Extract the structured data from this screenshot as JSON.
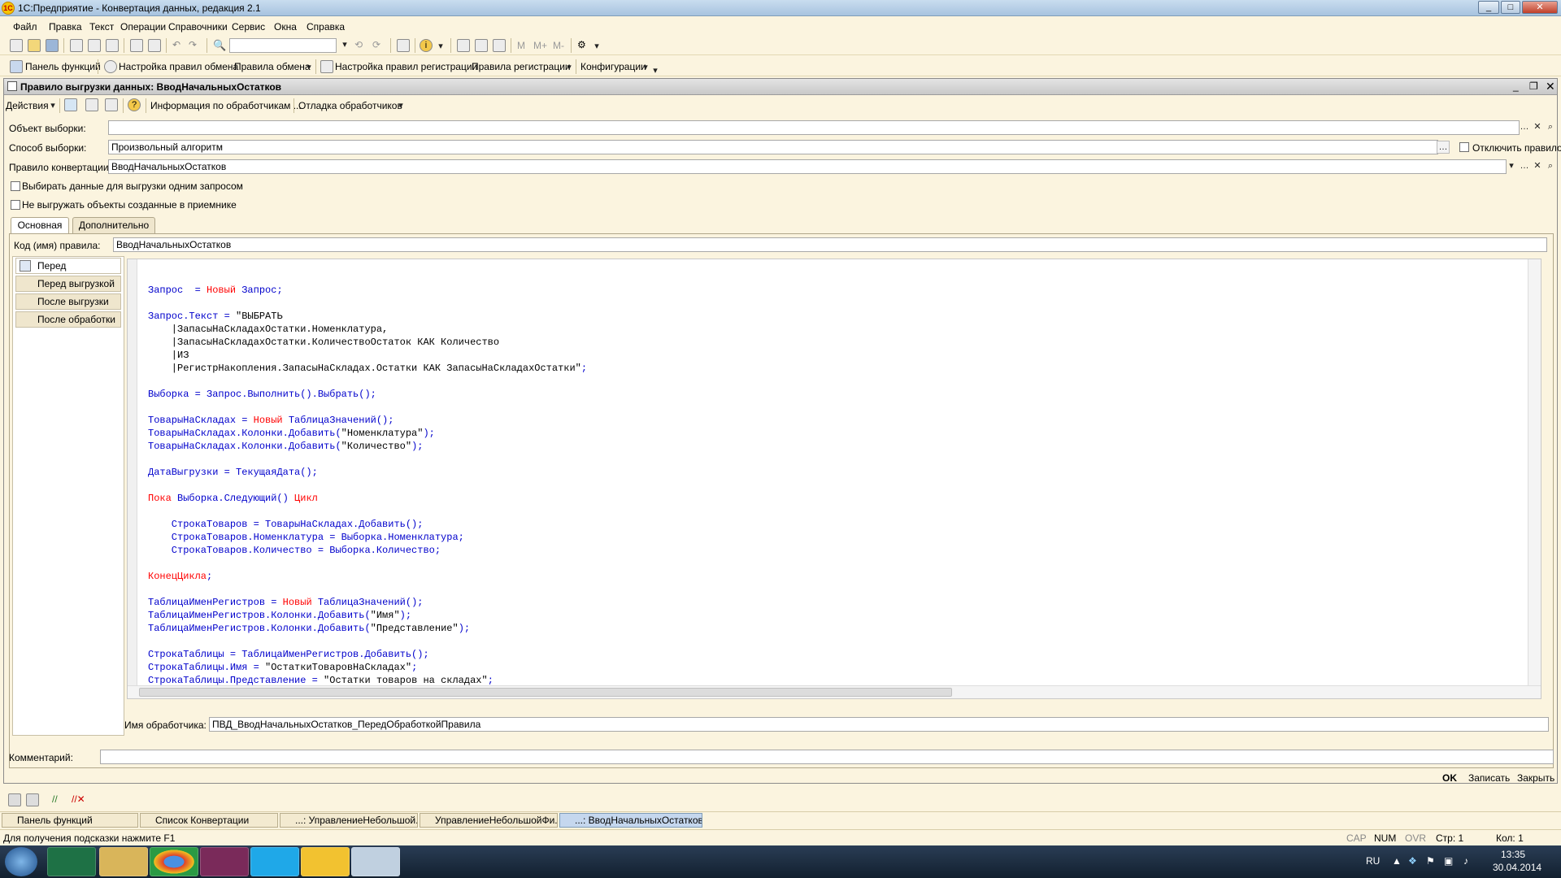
{
  "app": {
    "title": "1С:Предприятие - Конвертация данных, редакция 2.1"
  },
  "menu": [
    "Файл",
    "Правка",
    "Текст",
    "Операции",
    "Справочники",
    "Сервис",
    "Окна",
    "Справка"
  ],
  "toolbar2": {
    "panel": "Панель функций",
    "rules_settings": "Настройка правил обмена",
    "rules": "Правила обмена",
    "reg_settings": "Настройка правил регистрации",
    "reg_rules": "Правила регистрации",
    "configs": "Конфигурации"
  },
  "doc": {
    "title": "Правило выгрузки данных: ВводНачальныхОстатков",
    "actions": "Действия",
    "info": "Информация по обработчикам ...",
    "debug": "Отладка обработчиков",
    "object_label": "Объект выборки:",
    "object_value": "",
    "method_label": "Способ выборки:",
    "method_value": "Произвольный алгоритм",
    "disable_label": "Отключить правило",
    "conv_label": "Правило конвертации:",
    "conv_value": "ВводНачальныхОстатков",
    "cb1": "Выбирать данные для выгрузки одним запросом",
    "cb2": "Не выгружать объекты созданные в приемнике",
    "tab_main": "Основная",
    "tab_extra": "Дополнительно",
    "code_label": "Код (имя) правила:",
    "code_value": "ВводНачальныхОстатков",
    "handlers": [
      "Перед обработкой",
      "Перед выгрузкой",
      "После выгрузки",
      "После обработки"
    ],
    "handler_name_label": "Имя обработчика:",
    "handler_name_value": "ПВД_ВводНачальныхОстатков_ПередОбработкойПравила",
    "comment_label": "Комментарий:",
    "comment_value": "",
    "ok": "OK",
    "save": "Записать",
    "close": "Закрыть"
  },
  "taskstrip": [
    "Панель функций",
    "Список Конвертации",
    "...: УправлениеНебольшой...",
    "УправлениеНебольшойФи...",
    "...: ВводНачальныхОстатков"
  ],
  "status": {
    "hint": "Для получения подсказки нажмите F1",
    "cap": "CAP",
    "num": "NUM",
    "ovr": "OVR",
    "line": "Стр: 1",
    "col": "Кол: 1"
  },
  "tray": {
    "lang": "RU",
    "time": "13:35",
    "date": "30.04.2014"
  }
}
